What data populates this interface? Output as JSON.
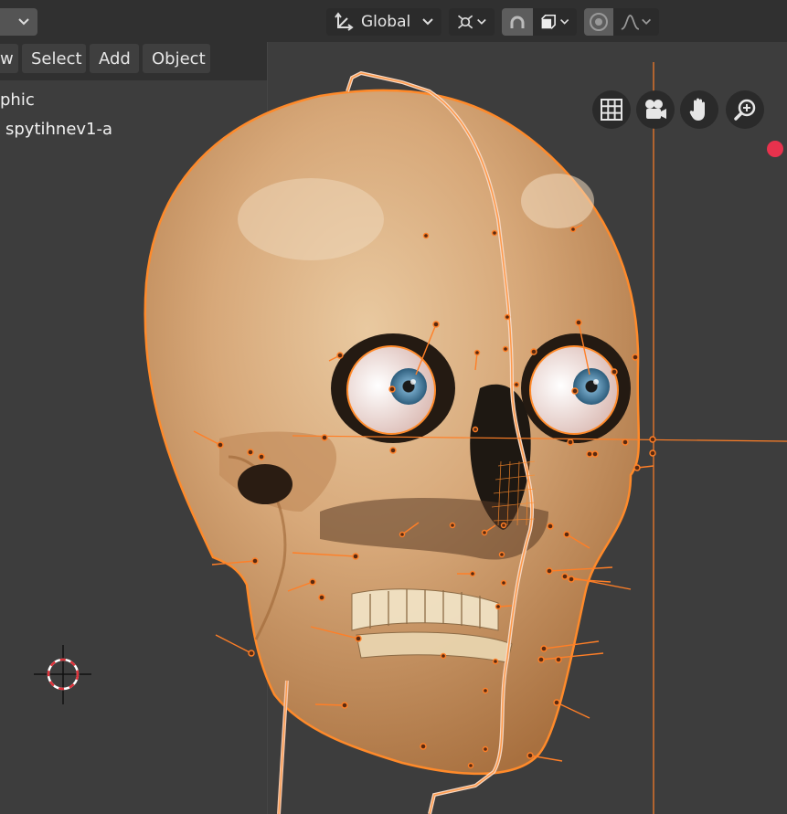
{
  "header": {
    "transform_orientation": "Global",
    "menu": [
      "w",
      "Select",
      "Add",
      "Object"
    ]
  },
  "viewport": {
    "info_line_1": "phic",
    "info_line_2": "spytihnev1-a",
    "navigation": [
      "grid-icon",
      "camera-icon",
      "hand-icon",
      "zoom-icon"
    ]
  },
  "colors": {
    "accent_orange": "#ff7f27",
    "record_red": "#e8324d",
    "header_bg": "#303030",
    "viewport_bg": "#3d3d3d"
  }
}
